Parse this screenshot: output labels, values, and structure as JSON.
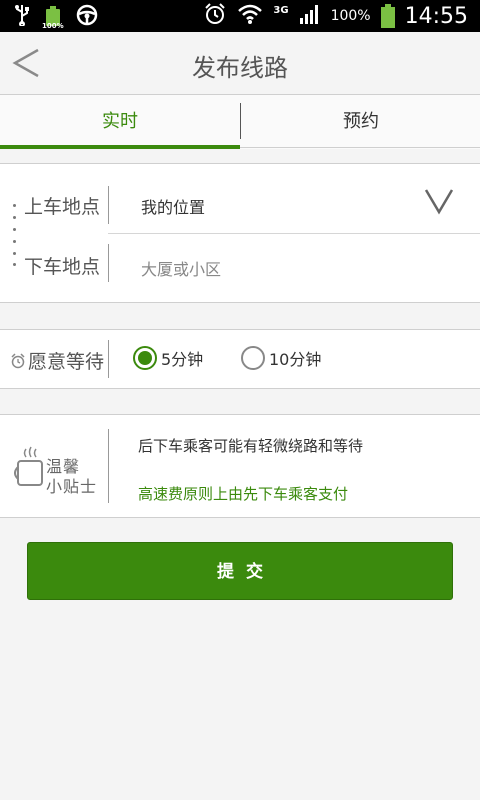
{
  "status_bar": {
    "battery_small_label": "100%",
    "network": "3G",
    "battery_percent": "100%",
    "time": "14:55"
  },
  "header": {
    "title": "发布线路"
  },
  "tabs": [
    {
      "label": "实时"
    },
    {
      "label": "预约"
    }
  ],
  "route": {
    "pickup_label": "上车地点",
    "pickup_value": "我的位置",
    "dropoff_label": "下车地点",
    "dropoff_placeholder": "大厦或小区"
  },
  "wait": {
    "label": "愿意等待",
    "options": [
      {
        "label": "5分钟",
        "selected": true
      },
      {
        "label": "10分钟",
        "selected": false
      }
    ]
  },
  "tips": {
    "title_line1": "温馨",
    "title_line2": "小贴士",
    "line1": "后下车乘客可能有轻微绕路和等待",
    "line2": "高速费原则上由先下车乘客支付"
  },
  "submit": {
    "label": "提交"
  },
  "colors": {
    "accent": "#3b8a0d",
    "status_bar": "#000000",
    "battery": "#7bc043"
  }
}
